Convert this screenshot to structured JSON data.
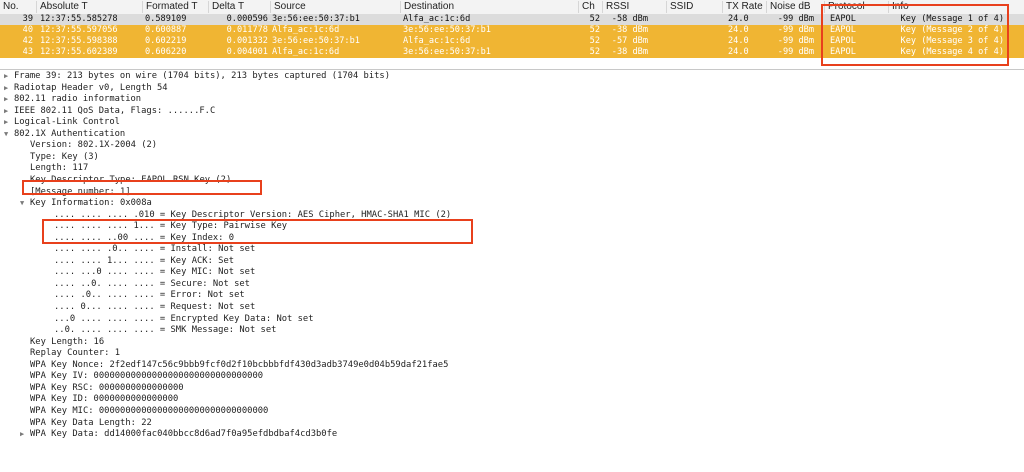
{
  "columns": [
    "No.",
    "Absolute T",
    "Formated T",
    "Delta T",
    "Source",
    "Destination",
    "Ch",
    "RSSI",
    "SSID",
    "TX Rate",
    "Noise dB",
    "Protocol",
    "Info"
  ],
  "packets": [
    {
      "no": "39",
      "abs": "12:37:55.585278",
      "fmt": "0.589109",
      "delta": "0.000596",
      "src": "3e:56:ee:50:37:b1",
      "dst": "Alfa_ac:1c:6d",
      "ch": "52",
      "rssi": "-58 dBm",
      "ssid": "",
      "tx": "24.0",
      "noise": "-99 dBm",
      "proto": "EAPOL",
      "info": "Key (Message 1 of 4)"
    },
    {
      "no": "40",
      "abs": "12:37:55.597056",
      "fmt": "0.600887",
      "delta": "0.011778",
      "src": "Alfa_ac:1c:6d",
      "dst": "3e:56:ee:50:37:b1",
      "ch": "52",
      "rssi": "-38 dBm",
      "ssid": "",
      "tx": "24.0",
      "noise": "-99 dBm",
      "proto": "EAPOL",
      "info": "Key (Message 2 of 4)"
    },
    {
      "no": "42",
      "abs": "12:37:55.598388",
      "fmt": "0.602219",
      "delta": "0.001332",
      "src": "3e:56:ee:50:37:b1",
      "dst": "Alfa_ac:1c:6d",
      "ch": "52",
      "rssi": "-57 dBm",
      "ssid": "",
      "tx": "24.0",
      "noise": "-99 dBm",
      "proto": "EAPOL",
      "info": "Key (Message 3 of 4)"
    },
    {
      "no": "43",
      "abs": "12:37:55.602389",
      "fmt": "0.606220",
      "delta": "0.004001",
      "src": "Alfa_ac:1c:6d",
      "dst": "3e:56:ee:50:37:b1",
      "ch": "52",
      "rssi": "-38 dBm",
      "ssid": "",
      "tx": "24.0",
      "noise": "-99 dBm",
      "proto": "EAPOL",
      "info": "Key (Message 4 of 4)"
    }
  ],
  "details": [
    {
      "indent": 0,
      "tri": "right",
      "text": "Frame 39: 213 bytes on wire (1704 bits), 213 bytes captured (1704 bits)"
    },
    {
      "indent": 0,
      "tri": "right",
      "text": "Radiotap Header v0, Length 54"
    },
    {
      "indent": 0,
      "tri": "right",
      "text": "802.11 radio information"
    },
    {
      "indent": 0,
      "tri": "right",
      "text": "IEEE 802.11 QoS Data, Flags: ......F.C"
    },
    {
      "indent": 0,
      "tri": "right",
      "text": "Logical-Link Control"
    },
    {
      "indent": 0,
      "tri": "down",
      "text": "802.1X Authentication"
    },
    {
      "indent": 1,
      "tri": "",
      "text": "Version: 802.1X-2004 (2)"
    },
    {
      "indent": 1,
      "tri": "",
      "text": "Type: Key (3)"
    },
    {
      "indent": 1,
      "tri": "",
      "text": "Length: 117"
    },
    {
      "indent": 1,
      "tri": "",
      "text": "Key Descriptor Type: EAPOL RSN Key (2)"
    },
    {
      "indent": 1,
      "tri": "",
      "text": "[Message number: 1]"
    },
    {
      "indent": 1,
      "tri": "down",
      "text": "Key Information: 0x008a"
    },
    {
      "indent": 2,
      "tri": "",
      "text": ".... .... .... .010 = Key Descriptor Version: AES Cipher, HMAC-SHA1 MIC (2)"
    },
    {
      "indent": 2,
      "tri": "",
      "text": ".... .... .... 1... = Key Type: Pairwise Key"
    },
    {
      "indent": 2,
      "tri": "",
      "text": ".... .... ..00 .... = Key Index: 0"
    },
    {
      "indent": 2,
      "tri": "",
      "text": ".... .... .0.. .... = Install: Not set"
    },
    {
      "indent": 2,
      "tri": "",
      "text": ".... .... 1... .... = Key ACK: Set"
    },
    {
      "indent": 2,
      "tri": "",
      "text": ".... ...0 .... .... = Key MIC: Not set"
    },
    {
      "indent": 2,
      "tri": "",
      "text": ".... ..0. .... .... = Secure: Not set"
    },
    {
      "indent": 2,
      "tri": "",
      "text": ".... .0.. .... .... = Error: Not set"
    },
    {
      "indent": 2,
      "tri": "",
      "text": ".... 0... .... .... = Request: Not set"
    },
    {
      "indent": 2,
      "tri": "",
      "text": "...0 .... .... .... = Encrypted Key Data: Not set"
    },
    {
      "indent": 2,
      "tri": "",
      "text": "..0. .... .... .... = SMK Message: Not set"
    },
    {
      "indent": 1,
      "tri": "",
      "text": "Key Length: 16"
    },
    {
      "indent": 1,
      "tri": "",
      "text": "Replay Counter: 1"
    },
    {
      "indent": 1,
      "tri": "",
      "text": "WPA Key Nonce: 2f2edf147c56c9bbb9fcf0d2f10bcbbbfdf430d3adb3749e0d04b59daf21fae5"
    },
    {
      "indent": 1,
      "tri": "",
      "text": "WPA Key IV: 00000000000000000000000000000000"
    },
    {
      "indent": 1,
      "tri": "",
      "text": "WPA Key RSC: 0000000000000000"
    },
    {
      "indent": 1,
      "tri": "",
      "text": "WPA Key ID: 0000000000000000"
    },
    {
      "indent": 1,
      "tri": "",
      "text": "WPA Key MIC: 00000000000000000000000000000000"
    },
    {
      "indent": 1,
      "tri": "",
      "text": "WPA Key Data Length: 22"
    },
    {
      "indent": 1,
      "tri": "right",
      "text": "WPA Key Data: dd14000fac040bbcc8d6ad7f0a95efdbdbaf4cd3b0fe"
    }
  ],
  "colors": {
    "eapol_row": "#f0b533",
    "selected_row": "#dcdcdc",
    "highlight_box": "#e8401c"
  }
}
